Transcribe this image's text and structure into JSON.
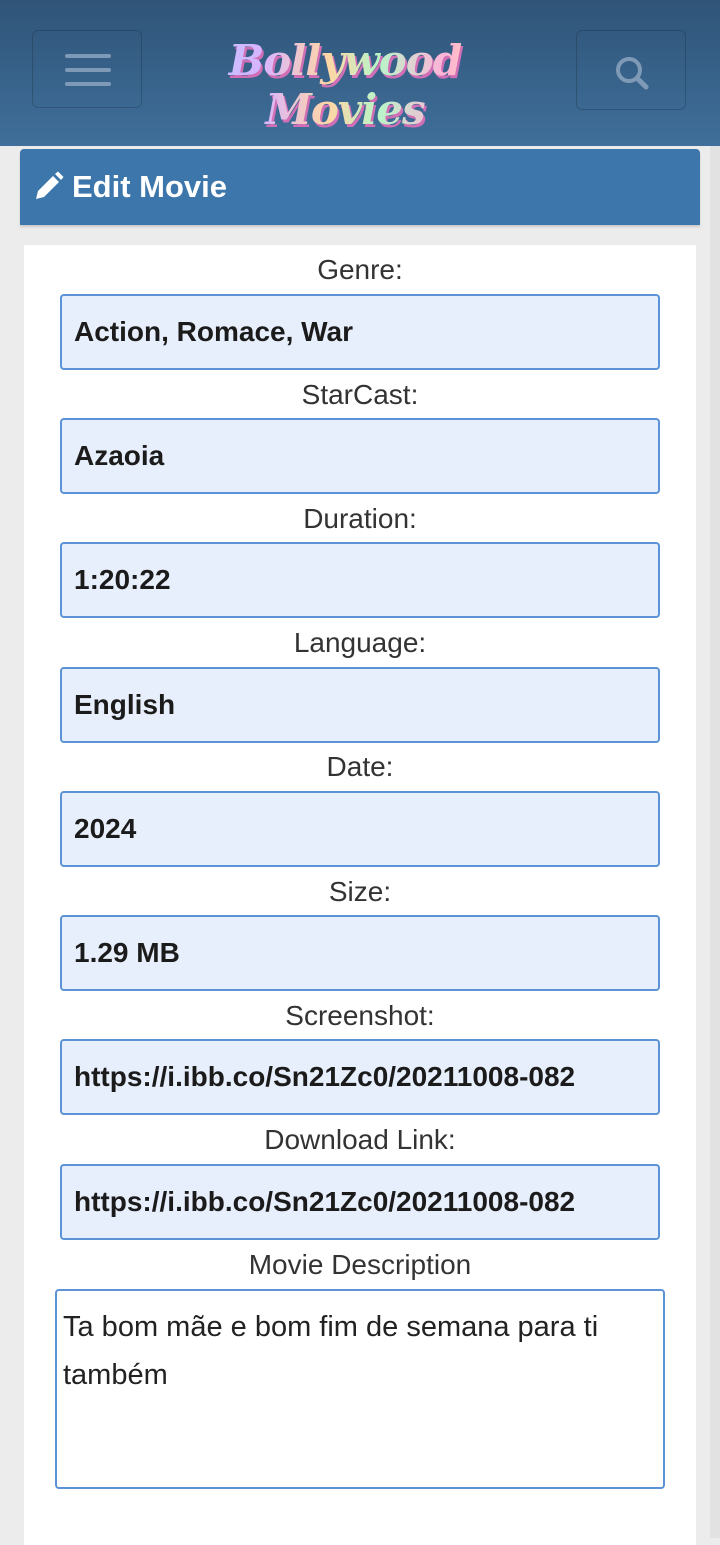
{
  "header": {
    "logo_text": "Bollywood Movies",
    "menu_icon": "hamburger-menu-icon",
    "search_icon": "search-icon"
  },
  "panel": {
    "title": "Edit Movie",
    "title_icon": "pencil-icon"
  },
  "form": {
    "fields": [
      {
        "label": "Genre:",
        "value": "Action, Romace, War"
      },
      {
        "label": "StarCast:",
        "value": "Azaoia"
      },
      {
        "label": "Duration:",
        "value": "1:20:22"
      },
      {
        "label": "Language:",
        "value": "English"
      },
      {
        "label": "Date:",
        "value": "2024"
      },
      {
        "label": "Size:",
        "value": "1.29 MB"
      },
      {
        "label": "Screenshot:",
        "value": "https://i.ibb.co/Sn21Zc0/20211008-082"
      },
      {
        "label": "Download Link:",
        "value": "https://i.ibb.co/Sn21Zc0/20211008-082"
      }
    ],
    "description_label": "Movie Description",
    "description_value": "Ta bom mãe e bom fim de semana para ti também"
  },
  "colors": {
    "navbar": "#3a6690",
    "panel_header": "#3d76aa",
    "input_bg": "#e8effc",
    "input_border": "#5b93d6"
  }
}
